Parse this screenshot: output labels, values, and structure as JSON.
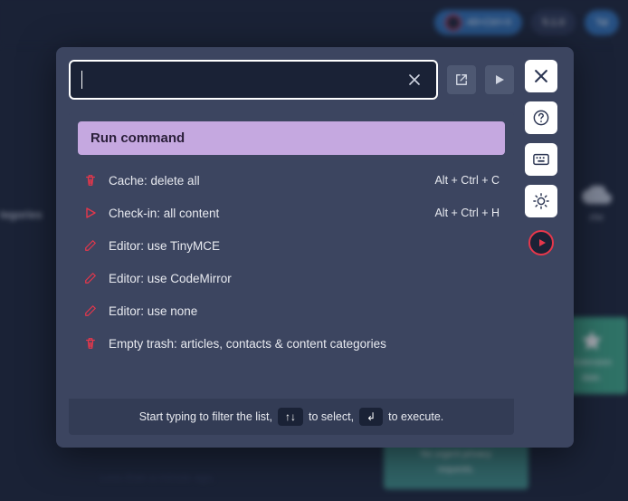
{
  "background": {
    "pill1": "All+Ctrl+X",
    "pill2": "5.1.0",
    "pill3": "Tal",
    "left_label": "tegories",
    "cloud_label": "che",
    "green1_line1": "Extension",
    "green1_line2": "date.",
    "green2_line1": "No urgent privacy",
    "green2_line2": "requests.",
    "bottom_text": "Less than a minute ago."
  },
  "search": {
    "value": "",
    "placeholder": ""
  },
  "section_header": "Run command",
  "commands": [
    {
      "icon": "trash",
      "label": "Cache: delete all",
      "shortcut": "Alt + Ctrl + C"
    },
    {
      "icon": "play",
      "label": "Check-in: all content",
      "shortcut": "Alt + Ctrl + H"
    },
    {
      "icon": "pencil",
      "label": "Editor: use TinyMCE",
      "shortcut": ""
    },
    {
      "icon": "pencil",
      "label": "Editor: use CodeMirror",
      "shortcut": ""
    },
    {
      "icon": "pencil",
      "label": "Editor: use none",
      "shortcut": ""
    },
    {
      "icon": "trash",
      "label": "Empty trash: articles, contacts & content categories",
      "shortcut": ""
    }
  ],
  "footer": {
    "part1": "Start typing to filter the list,",
    "key1": "↑↓",
    "part2": "to select,",
    "key2": "↲",
    "part3": "to execute."
  },
  "side_buttons": {
    "close": "close-icon",
    "help": "help-icon",
    "keyboard": "keyboard-icon",
    "theme": "brightness-icon",
    "record": "record-icon"
  }
}
